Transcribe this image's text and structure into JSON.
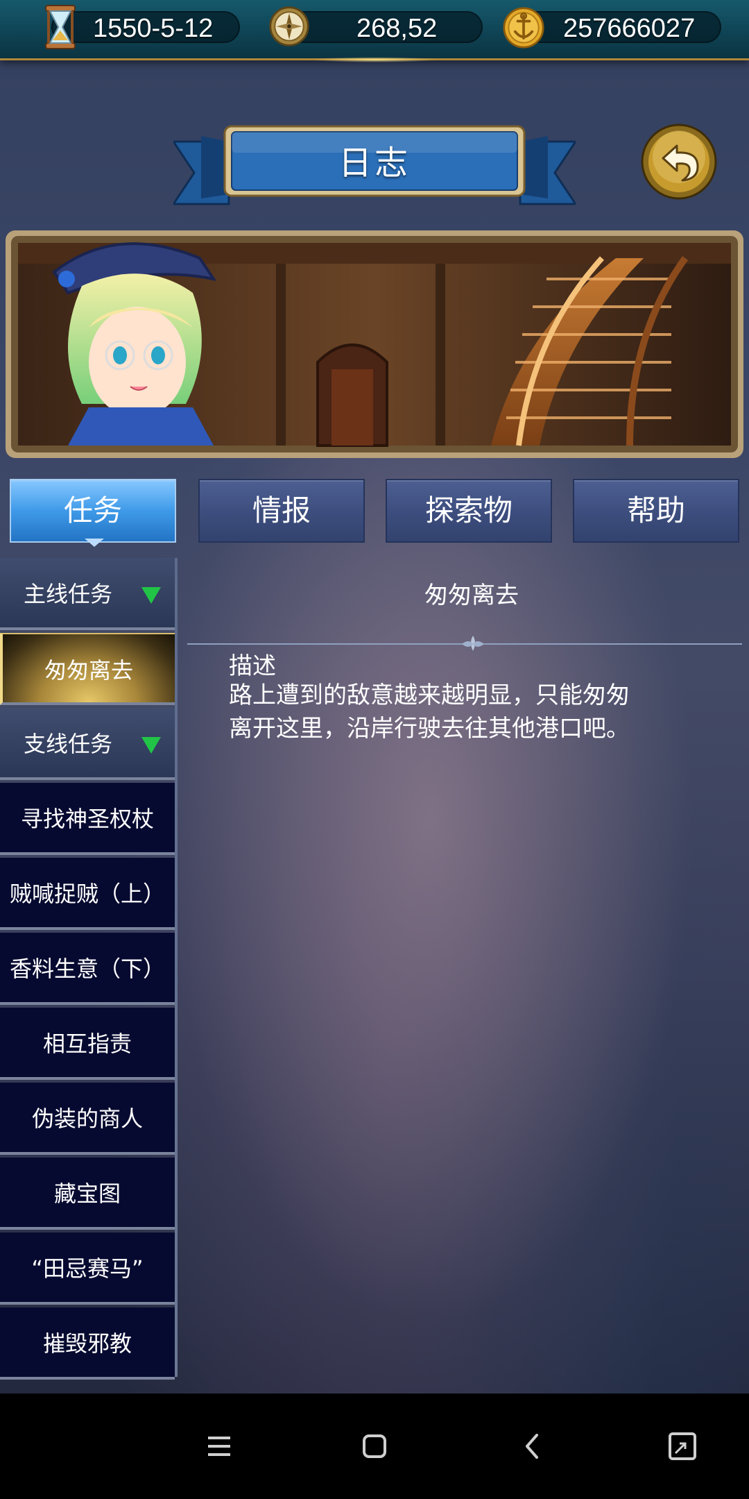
{
  "topbar": {
    "date": "1550-5-12",
    "coordinates": "268,52",
    "gold": "257666027",
    "icons": [
      "hourglass-icon",
      "compass-icon",
      "anchor-coin-icon"
    ]
  },
  "header": {
    "title": "日志",
    "back_icon": "back-arrow-icon"
  },
  "tabs": [
    {
      "label": "任务",
      "active": true
    },
    {
      "label": "情报",
      "active": false
    },
    {
      "label": "探索物",
      "active": false
    },
    {
      "label": "帮助",
      "active": false
    }
  ],
  "sidebar": {
    "main_header": "主线任务",
    "main_items": [
      "匆匆离去"
    ],
    "side_header": "支线任务",
    "side_items": [
      "寻找神圣权杖",
      "贼喊捉贼（上）",
      "香料生意（下）",
      "相互指责",
      "伪装的商人",
      "藏宝图",
      "“田忌赛马”",
      "摧毁邪教"
    ]
  },
  "detail": {
    "title": "匆匆离去",
    "desc_label": "描述",
    "desc_line1": "路上遭到的敌意越来越明显，只能匆匆",
    "desc_line2": "离开这里，沿岸行驶去往其他港口吧。"
  },
  "navbar": {
    "icons": [
      "menu-icon",
      "home-icon",
      "back-icon",
      "recent-icon"
    ]
  }
}
